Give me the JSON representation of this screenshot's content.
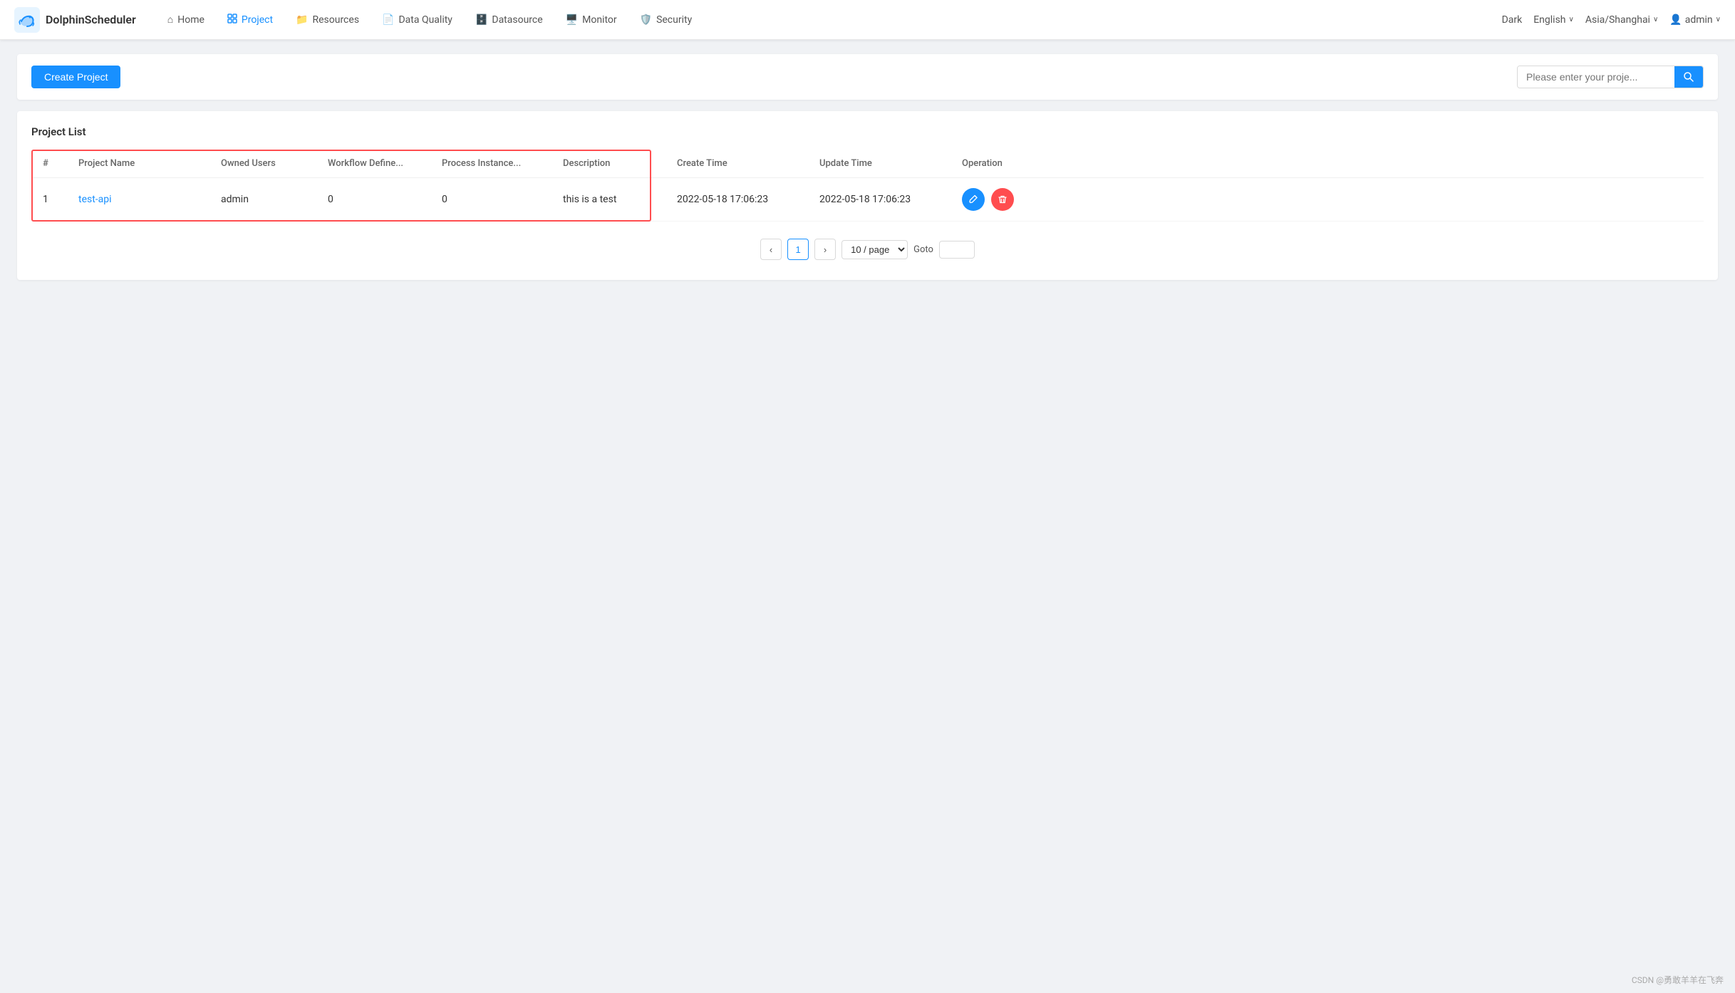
{
  "brand": {
    "name": "DolphinScheduler"
  },
  "navbar": {
    "items": [
      {
        "id": "home",
        "label": "Home",
        "icon": "🏠",
        "active": false
      },
      {
        "id": "project",
        "label": "Project",
        "icon": "📋",
        "active": true
      },
      {
        "id": "resources",
        "label": "Resources",
        "icon": "📁",
        "active": false
      },
      {
        "id": "data-quality",
        "label": "Data Quality",
        "icon": "📄",
        "active": false
      },
      {
        "id": "datasource",
        "label": "Datasource",
        "icon": "🗄️",
        "active": false
      },
      {
        "id": "monitor",
        "label": "Monitor",
        "icon": "🖥️",
        "active": false
      },
      {
        "id": "security",
        "label": "Security",
        "icon": "🛡️",
        "active": false
      }
    ],
    "right": {
      "theme": "Dark",
      "language": "English",
      "timezone": "Asia/Shanghai",
      "user": "admin"
    }
  },
  "toolbar": {
    "create_button_label": "Create Project",
    "search_placeholder": "Please enter your proje..."
  },
  "section": {
    "title": "Project List"
  },
  "table": {
    "columns": [
      "#",
      "Project Name",
      "Owned Users",
      "Workflow Define...",
      "Process Instance...",
      "Description",
      "Create Time",
      "Update Time",
      "Operation"
    ],
    "rows": [
      {
        "index": "1",
        "project_name": "test-api",
        "owned_users": "admin",
        "workflow_define": "0",
        "process_instance": "0",
        "description": "this is a test",
        "create_time": "2022-05-18 17:06:23",
        "update_time": "2022-05-18 17:06:23"
      }
    ]
  },
  "pagination": {
    "current_page": "1",
    "page_size_label": "10 / page",
    "goto_label": "Goto",
    "prev_icon": "‹",
    "next_icon": "›"
  },
  "footer": {
    "credit": "CSDN @勇敢羊羊在飞奔"
  },
  "icons": {
    "search": "🔍",
    "edit": "✏️",
    "delete": "🗑️",
    "shield": "🛡",
    "home": "⌂",
    "folder": "📁",
    "doc": "📄",
    "db": "🗄",
    "monitor": "🖥",
    "project": "📋",
    "user": "👤"
  }
}
